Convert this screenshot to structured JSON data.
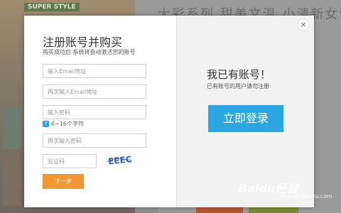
{
  "background": {
    "brand_label": "SUPER STYLE",
    "headline": "大彩系列 甜美文温 小清新女性化",
    "watermark": "Baidu经验",
    "watermark_sub": "jingyan.baidu.com"
  },
  "register": {
    "title": "注册账号并购买",
    "subtitle": "购买成功后 系统将自动激活您的账号",
    "email_placeholder": "输入Email地址",
    "email_confirm_placeholder": "再次输入Email地址",
    "password_placeholder": "输入密码",
    "password_hint": "6~16个字符",
    "password_confirm_placeholder": "再次输入密码",
    "captcha_placeholder": "验证码",
    "captcha_text": "EEEC",
    "next_label": "下一步"
  },
  "login": {
    "title": "我已有账号！",
    "subtitle": "已有账号的用户请勿注册",
    "button_label": "立即登录"
  },
  "close_label": "×",
  "colors": {
    "next_button": "#f39531",
    "login_button": "#2aa6e0",
    "hint_icon": "#3a9fd8"
  }
}
